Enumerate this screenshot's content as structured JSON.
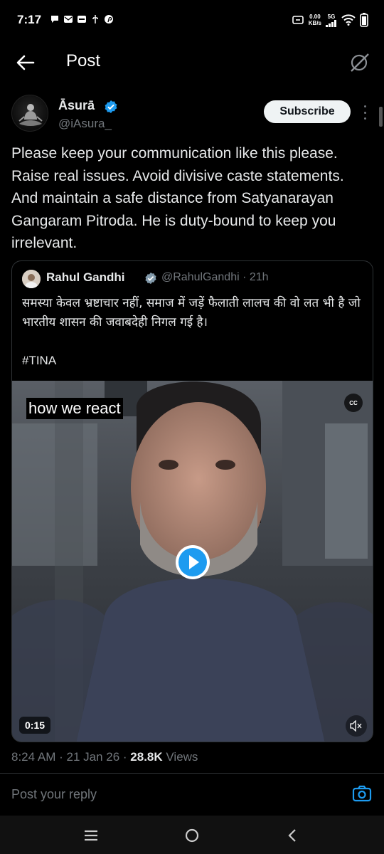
{
  "status_bar": {
    "time": "7:17",
    "net_speed": "0.00",
    "net_unit": "KB/s",
    "network": "5G"
  },
  "header": {
    "title": "Post",
    "back_icon": "arrow-left-icon",
    "grok_icon": "grok-icon"
  },
  "post": {
    "author_name": "Āsurā",
    "author_handle": "@iAsura_",
    "subscribe_label": "Subscribe",
    "text": "Please keep your communication like this please. Raise real issues. Avoid divisive caste statements. And maintain a safe distance from Satyanarayan Gangaram Pitroda. He is duty-bound to keep you irrelevant.",
    "quoted": {
      "author_name": "Rahul Gandhi",
      "author_handle": "@RahulGandhi",
      "age": "21h",
      "text": "समस्या केवल भ्रष्टाचार नहीं, समाज में जड़ें फैलाती लालच की वो लत भी है जो भारतीय शासन की जवाबदेही निगल गई है।",
      "hashtag": "#TINA",
      "video": {
        "caption": "how we react",
        "cc_label": "CC",
        "duration": "0:15"
      }
    },
    "meta": {
      "time": "8:24 AM",
      "date": "21 Jan 26",
      "views_count": "28.8K",
      "views_label": "Views"
    }
  },
  "reply": {
    "placeholder": "Post your reply"
  },
  "colors": {
    "background": "#000000",
    "verified_blue": "#1d9bf0",
    "muted_text": "#71767b"
  }
}
